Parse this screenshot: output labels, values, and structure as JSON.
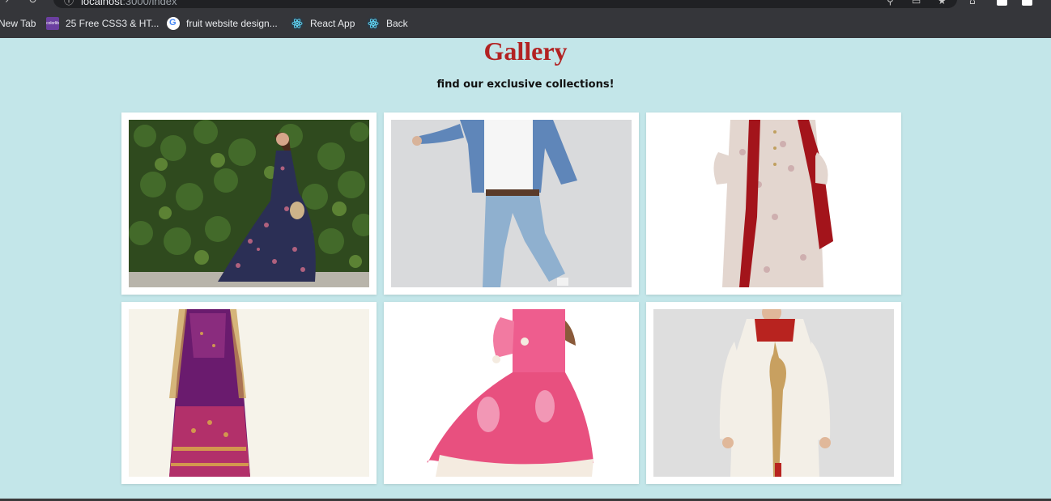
{
  "browser": {
    "url_host": "localhost",
    "url_rest": ":3000/index",
    "bookmarks": [
      {
        "label": "New Tab",
        "icon": "none"
      },
      {
        "label": "25 Free CSS3 & HT...",
        "icon": "colorlib-icon",
        "favicon_text": "colorlib"
      },
      {
        "label": "fruit website design...",
        "icon": "google-icon"
      },
      {
        "label": "React App",
        "icon": "react-icon"
      },
      {
        "label": "Back",
        "icon": "react-icon"
      }
    ]
  },
  "page": {
    "title": "Gallery",
    "subtitle": "find our exclusive collections!",
    "background_color": "#c3e6e9",
    "title_color": "#b22222"
  },
  "gallery": {
    "items": [
      {
        "description_icon": "floral-maxi-dress-photo"
      },
      {
        "description_icon": "denim-shirt-jeans-photo"
      },
      {
        "description_icon": "sherwani-with-red-dupatta-photo"
      },
      {
        "description_icon": "purple-lehenga-photo"
      },
      {
        "description_icon": "pink-princess-dress-photo"
      },
      {
        "description_icon": "kids-white-sherwani-photo"
      }
    ]
  }
}
